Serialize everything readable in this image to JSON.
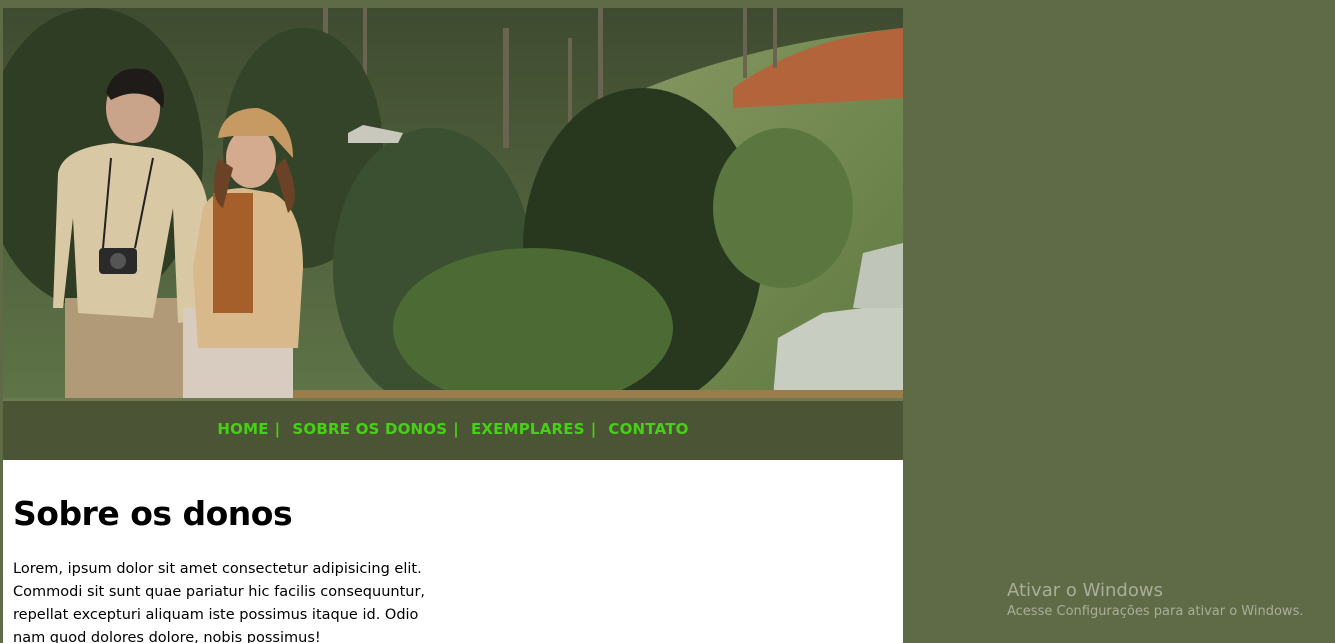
{
  "nav": {
    "items": [
      {
        "label": "HOME"
      },
      {
        "label": "SOBRE OS DONOS"
      },
      {
        "label": "EXEMPLARES"
      },
      {
        "label": "CONTATO"
      }
    ],
    "separator": "|",
    "color": "#47d116"
  },
  "main": {
    "title": "Sobre os donos",
    "text": "Lorem, ipsum dolor sit amet consectetur adipisicing elit. Commodi sit sunt quae pariatur hic facilis consequuntur, repellat excepturi aliquam iste possimus itaque id. Odio nam quod dolores dolore, nobis possimus!"
  },
  "hero": {
    "icon": "couple-photo-image"
  },
  "watermark": {
    "title": "Ativar o Windows",
    "subtitle": "Acesse Configurações para ativar o Windows."
  },
  "colors": {
    "background": "#5e6b46",
    "navbar": "#4b5535",
    "content": "#ffffff"
  }
}
